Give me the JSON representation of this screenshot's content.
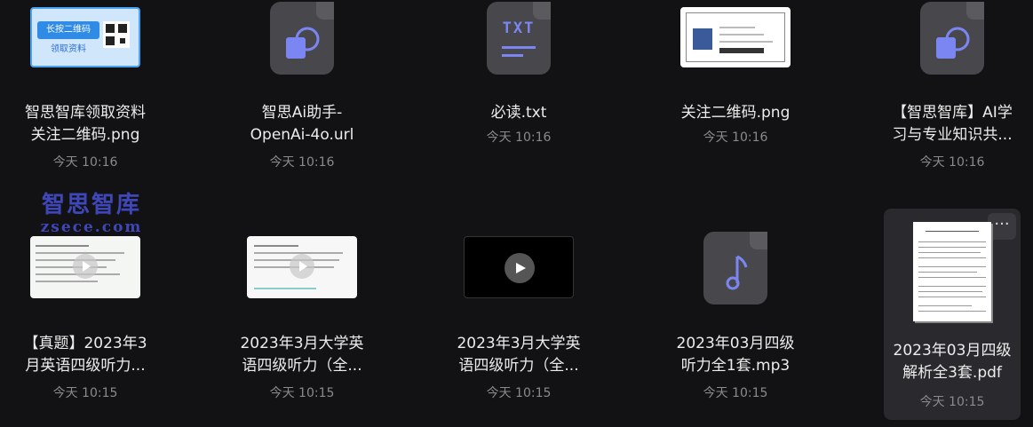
{
  "files": [
    {
      "name": "智思智库领取资料\n关注二维码.png",
      "date": "今天 10:16",
      "icon": "image-thumbnail",
      "thumb_text_1": "长按二维码",
      "thumb_text_2": "领取资料"
    },
    {
      "name": "智思Ai助手-\nOpenAi-4o.url",
      "date": "今天 10:16",
      "icon": "link-file-icon"
    },
    {
      "name": "必读.txt",
      "date": "今天 10:16",
      "icon": "txt-file-icon",
      "icon_label": "TXT"
    },
    {
      "name": "关注二维码.png",
      "date": "今天 10:16",
      "icon": "image-thumbnail"
    },
    {
      "name": "【智思智库】AI学\n习与专业知识共...",
      "date": "今天 10:16",
      "icon": "link-file-icon"
    },
    {
      "name": "【真题】2023年3\n月英语四级听力...",
      "date": "今天 10:15",
      "icon": "video-thumbnail"
    },
    {
      "name": "2023年3月大学英\n语四级听力（全...",
      "date": "今天 10:15",
      "icon": "video-thumbnail"
    },
    {
      "name": "2023年3月大学英\n语四级听力（全...",
      "date": "今天 10:15",
      "icon": "video-thumbnail"
    },
    {
      "name": "2023年03月四级\n听力全1套.mp3",
      "date": "今天 10:15",
      "icon": "audio-file-icon"
    },
    {
      "name": "2023年03月四级\n解析全3套.pdf",
      "date": "今天 10:15",
      "icon": "pdf-thumbnail"
    }
  ],
  "watermark": {
    "line1": "智思智库",
    "line2": "zsece.com"
  },
  "more_button_label": "···",
  "colors": {
    "background": "#121214",
    "selected": "#2a2a2e",
    "accent": "#7b86f2",
    "watermark": "#3f47b8"
  }
}
